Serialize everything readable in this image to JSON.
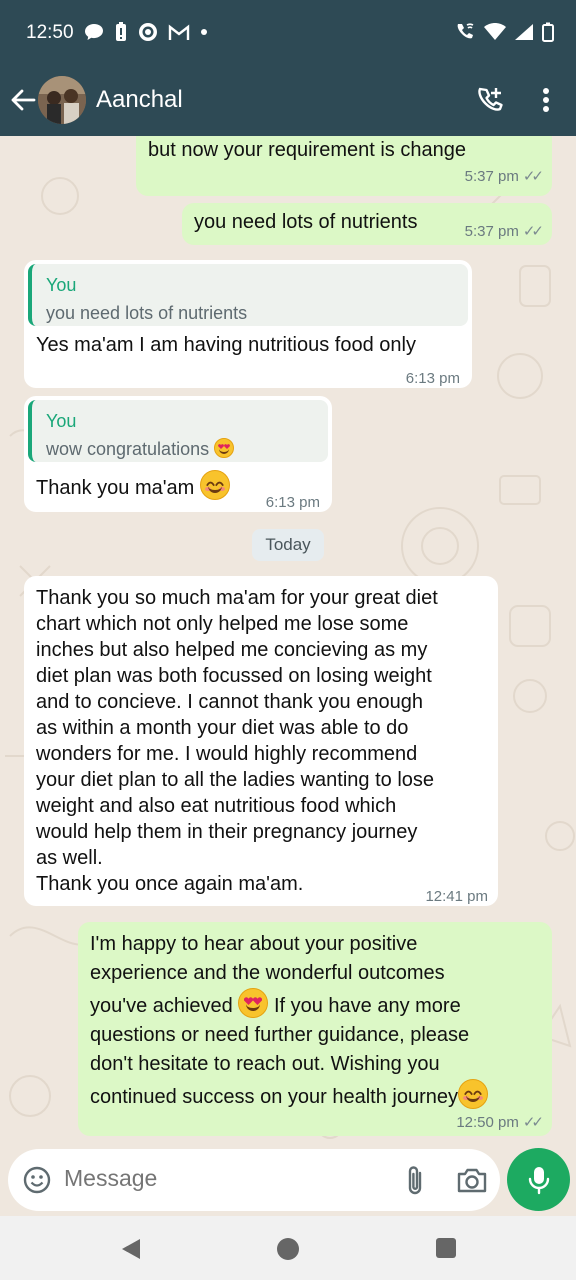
{
  "status_bar": {
    "time": "12:50",
    "left_icons": [
      "chat-bubble-icon",
      "battery-saver-icon",
      "whatsapp-icon",
      "gmail-icon",
      "dot-icon"
    ],
    "right_icons": [
      "wifi-call-icon",
      "wifi-icon",
      "signal-icon",
      "battery-icon"
    ]
  },
  "header": {
    "contact_name": "Aanchal",
    "actions": [
      "add-call-icon",
      "more-vert-icon"
    ]
  },
  "messages": [
    {
      "type": "outgoing",
      "text": "but now your requirement is change",
      "time": "5:37 pm",
      "status": "read"
    },
    {
      "type": "outgoing",
      "text": "you need lots of nutrients",
      "time": "5:37 pm",
      "status": "read"
    },
    {
      "type": "incoming",
      "quote_author": "You",
      "quote_text": "you need lots of nutrients",
      "text": "Yes ma'am I am having nutritious food only",
      "time": "6:13 pm"
    },
    {
      "type": "incoming",
      "quote_author": "You",
      "quote_text": "wow congratulations",
      "text": "Thank you ma'am",
      "time": "6:13 pm"
    },
    {
      "type": "date",
      "text": "Today"
    },
    {
      "type": "incoming",
      "lines": [
        "Thank you so much ma'am for your great diet",
        "chart which not only helped me lose some",
        "inches but also helped me concieving as my",
        "diet plan was both focussed on losing weight",
        "and to concieve. I cannot thank you enough",
        "as within a month your diet was able to do",
        "wonders for me. I would highly recommend",
        "your diet plan to all the ladies wanting to lose",
        "weight and also eat nutritious food which",
        "would help them in their pregnancy journey",
        "as well.",
        "Thank you once again ma'am."
      ],
      "time": "12:41 pm"
    },
    {
      "type": "outgoing",
      "lines": [
        "I'm happy to hear about your positive",
        "experience and the wonderful outcomes",
        "you've achieved",
        "If you have any more",
        "questions or need further guidance, please",
        "don't hesitate to reach out. Wishing you",
        "continued success on your health journey"
      ],
      "time": "12:50 pm",
      "status": "read"
    }
  ],
  "composer": {
    "placeholder": "Message"
  },
  "colors": {
    "header": "#2e4a55",
    "outgoing_bubble": "#dcf8c6",
    "incoming_bubble": "#ffffff",
    "accent": "#1daa61",
    "quote_accent": "#1aa779",
    "chat_background": "#efe7de"
  }
}
